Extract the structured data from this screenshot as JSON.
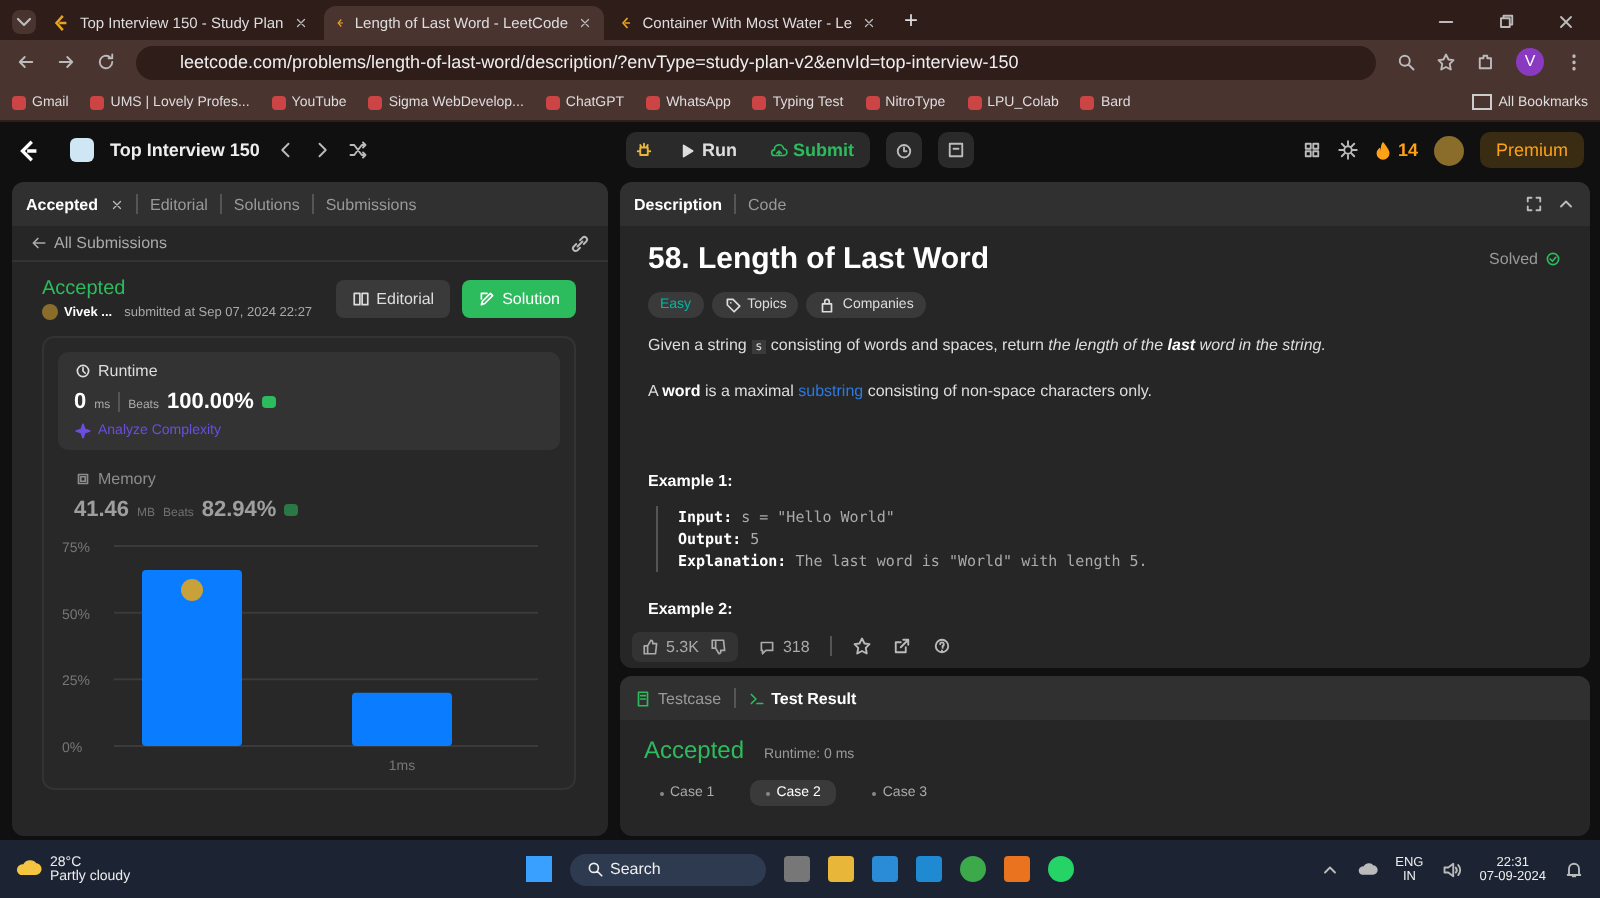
{
  "browser": {
    "tabs": [
      {
        "title": "Top Interview 150 - Study Plan",
        "selected": false
      },
      {
        "title": "Length of Last Word - LeetCode",
        "selected": true
      },
      {
        "title": "Container With Most Water - Le",
        "selected": false
      }
    ],
    "new_tab": "+",
    "url": "leetcode.com/problems/length-of-last-word/description/?envType=study-plan-v2&envId=top-interview-150",
    "profile": "V",
    "bookmarks": [
      "Gmail",
      "UMS | Lovely Profes...",
      "YouTube",
      "Sigma WebDevelop...",
      "ChatGPT",
      "WhatsApp",
      "Typing Test",
      "NitroType",
      "LPU_Colab",
      "Bard"
    ],
    "all_bookmarks": "All Bookmarks"
  },
  "topbar": {
    "plan": "Top Interview 150",
    "run": "Run",
    "submit": "Submit",
    "streak": "14",
    "premium": "Premium"
  },
  "left_panel": {
    "tabs": [
      {
        "label": "Accepted",
        "selected": true
      },
      {
        "label": "Editorial",
        "selected": false
      },
      {
        "label": "Solutions",
        "selected": false
      },
      {
        "label": "Submissions",
        "selected": false
      }
    ],
    "back": "All Submissions",
    "status": "Accepted",
    "user": "Vivek ...",
    "submitted": "submitted at Sep 07, 2024 22:27",
    "buttons": [
      "Editorial",
      "Solution"
    ],
    "runtime": {
      "title": "Runtime",
      "value": "0",
      "unit": "ms",
      "beats_label": "Beats",
      "beats": "100.00%",
      "analyze": "Analyze Complexity"
    },
    "memory": {
      "title": "Memory",
      "value": "41.46",
      "unit": "MB",
      "beats_label": "Beats",
      "beats": "82.94%"
    },
    "chart_data": {
      "type": "bar",
      "values": [
        66,
        20
      ],
      "ylim": [
        0,
        75
      ],
      "yticks": [
        {
          "value": 0,
          "label": "0%"
        },
        {
          "value": 25,
          "label": "25%"
        },
        {
          "value": 50,
          "label": "50%"
        },
        {
          "value": 75,
          "label": "75%"
        }
      ]
    },
    "bar_label": "1ms"
  },
  "problem": {
    "tabs": [
      {
        "label": "Description",
        "selected": true
      },
      {
        "label": "Code",
        "selected": false
      }
    ],
    "title": "58. Length of Last Word",
    "solved": "Solved",
    "tags": [
      "Easy",
      "Topics",
      "Companies"
    ],
    "paragraphs": [
      [
        {
          "kind": "text",
          "text": "Given a string "
        },
        {
          "kind": "code",
          "text": "s"
        },
        {
          "kind": "text",
          "text": " consisting of words and spaces, return "
        },
        {
          "kind": "italic",
          "text": "the length of the "
        },
        {
          "kind": "bolditalic",
          "text": "last"
        },
        {
          "kind": "italic",
          "text": " word in the string."
        }
      ],
      [
        {
          "kind": "text",
          "text": "A "
        },
        {
          "kind": "bold",
          "text": "word"
        },
        {
          "kind": "text",
          "text": " is a maximal "
        },
        {
          "kind": "link",
          "text": "substring"
        },
        {
          "kind": "text",
          "text": " consisting of non-space characters only."
        }
      ]
    ],
    "examples": [
      {
        "title": "Example 1:",
        "lines": [
          {
            "label": "Input:",
            "value": "s = \"Hello World\""
          },
          {
            "label": "Output:",
            "value": "5"
          },
          {
            "label": "Explanation:",
            "value": "The last word is \"World\" with length 5."
          }
        ]
      },
      {
        "title": "Example 2:"
      }
    ],
    "likes": "5.3K",
    "comments": "318"
  },
  "result": {
    "tabs": [
      {
        "label": "Testcase",
        "selected": false
      },
      {
        "label": "Test Result",
        "selected": true
      }
    ],
    "status": "Accepted",
    "runtime": "Runtime: 0 ms",
    "cases": [
      {
        "label": "Case 1",
        "selected": false
      },
      {
        "label": "Case 2",
        "selected": true
      },
      {
        "label": "Case 3",
        "selected": false
      }
    ]
  },
  "taskbar": {
    "temp": "28°C",
    "weather": "Partly cloudy",
    "search": "Search",
    "lang": "ENG",
    "region": "IN",
    "time": "22:31",
    "date": "07-09-2024"
  }
}
